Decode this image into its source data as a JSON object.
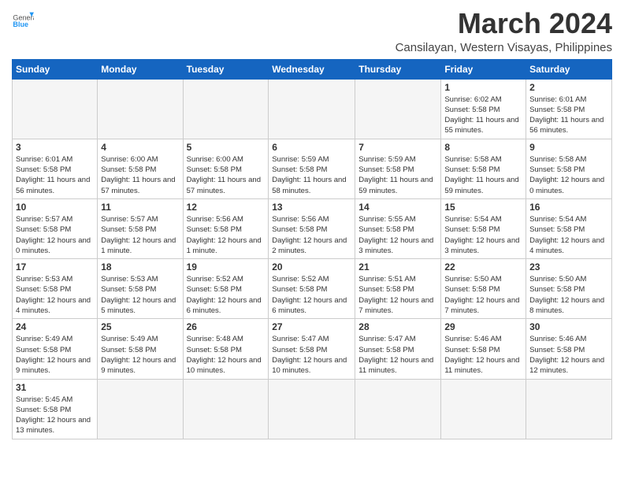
{
  "header": {
    "logo_general": "General",
    "logo_blue": "Blue",
    "month_title": "March 2024",
    "subtitle": "Cansilayan, Western Visayas, Philippines"
  },
  "days_of_week": [
    "Sunday",
    "Monday",
    "Tuesday",
    "Wednesday",
    "Thursday",
    "Friday",
    "Saturday"
  ],
  "weeks": [
    [
      {
        "day": "",
        "info": ""
      },
      {
        "day": "",
        "info": ""
      },
      {
        "day": "",
        "info": ""
      },
      {
        "day": "",
        "info": ""
      },
      {
        "day": "",
        "info": ""
      },
      {
        "day": "1",
        "info": "Sunrise: 6:02 AM\nSunset: 5:58 PM\nDaylight: 11 hours\nand 55 minutes."
      },
      {
        "day": "2",
        "info": "Sunrise: 6:01 AM\nSunset: 5:58 PM\nDaylight: 11 hours\nand 56 minutes."
      }
    ],
    [
      {
        "day": "3",
        "info": "Sunrise: 6:01 AM\nSunset: 5:58 PM\nDaylight: 11 hours\nand 56 minutes."
      },
      {
        "day": "4",
        "info": "Sunrise: 6:00 AM\nSunset: 5:58 PM\nDaylight: 11 hours\nand 57 minutes."
      },
      {
        "day": "5",
        "info": "Sunrise: 6:00 AM\nSunset: 5:58 PM\nDaylight: 11 hours\nand 57 minutes."
      },
      {
        "day": "6",
        "info": "Sunrise: 5:59 AM\nSunset: 5:58 PM\nDaylight: 11 hours\nand 58 minutes."
      },
      {
        "day": "7",
        "info": "Sunrise: 5:59 AM\nSunset: 5:58 PM\nDaylight: 11 hours\nand 59 minutes."
      },
      {
        "day": "8",
        "info": "Sunrise: 5:58 AM\nSunset: 5:58 PM\nDaylight: 11 hours\nand 59 minutes."
      },
      {
        "day": "9",
        "info": "Sunrise: 5:58 AM\nSunset: 5:58 PM\nDaylight: 12 hours\nand 0 minutes."
      }
    ],
    [
      {
        "day": "10",
        "info": "Sunrise: 5:57 AM\nSunset: 5:58 PM\nDaylight: 12 hours\nand 0 minutes."
      },
      {
        "day": "11",
        "info": "Sunrise: 5:57 AM\nSunset: 5:58 PM\nDaylight: 12 hours\nand 1 minute."
      },
      {
        "day": "12",
        "info": "Sunrise: 5:56 AM\nSunset: 5:58 PM\nDaylight: 12 hours\nand 1 minute."
      },
      {
        "day": "13",
        "info": "Sunrise: 5:56 AM\nSunset: 5:58 PM\nDaylight: 12 hours\nand 2 minutes."
      },
      {
        "day": "14",
        "info": "Sunrise: 5:55 AM\nSunset: 5:58 PM\nDaylight: 12 hours\nand 3 minutes."
      },
      {
        "day": "15",
        "info": "Sunrise: 5:54 AM\nSunset: 5:58 PM\nDaylight: 12 hours\nand 3 minutes."
      },
      {
        "day": "16",
        "info": "Sunrise: 5:54 AM\nSunset: 5:58 PM\nDaylight: 12 hours\nand 4 minutes."
      }
    ],
    [
      {
        "day": "17",
        "info": "Sunrise: 5:53 AM\nSunset: 5:58 PM\nDaylight: 12 hours\nand 4 minutes."
      },
      {
        "day": "18",
        "info": "Sunrise: 5:53 AM\nSunset: 5:58 PM\nDaylight: 12 hours\nand 5 minutes."
      },
      {
        "day": "19",
        "info": "Sunrise: 5:52 AM\nSunset: 5:58 PM\nDaylight: 12 hours\nand 6 minutes."
      },
      {
        "day": "20",
        "info": "Sunrise: 5:52 AM\nSunset: 5:58 PM\nDaylight: 12 hours\nand 6 minutes."
      },
      {
        "day": "21",
        "info": "Sunrise: 5:51 AM\nSunset: 5:58 PM\nDaylight: 12 hours\nand 7 minutes."
      },
      {
        "day": "22",
        "info": "Sunrise: 5:50 AM\nSunset: 5:58 PM\nDaylight: 12 hours\nand 7 minutes."
      },
      {
        "day": "23",
        "info": "Sunrise: 5:50 AM\nSunset: 5:58 PM\nDaylight: 12 hours\nand 8 minutes."
      }
    ],
    [
      {
        "day": "24",
        "info": "Sunrise: 5:49 AM\nSunset: 5:58 PM\nDaylight: 12 hours\nand 9 minutes."
      },
      {
        "day": "25",
        "info": "Sunrise: 5:49 AM\nSunset: 5:58 PM\nDaylight: 12 hours\nand 9 minutes."
      },
      {
        "day": "26",
        "info": "Sunrise: 5:48 AM\nSunset: 5:58 PM\nDaylight: 12 hours\nand 10 minutes."
      },
      {
        "day": "27",
        "info": "Sunrise: 5:47 AM\nSunset: 5:58 PM\nDaylight: 12 hours\nand 10 minutes."
      },
      {
        "day": "28",
        "info": "Sunrise: 5:47 AM\nSunset: 5:58 PM\nDaylight: 12 hours\nand 11 minutes."
      },
      {
        "day": "29",
        "info": "Sunrise: 5:46 AM\nSunset: 5:58 PM\nDaylight: 12 hours\nand 11 minutes."
      },
      {
        "day": "30",
        "info": "Sunrise: 5:46 AM\nSunset: 5:58 PM\nDaylight: 12 hours\nand 12 minutes."
      }
    ],
    [
      {
        "day": "31",
        "info": "Sunrise: 5:45 AM\nSunset: 5:58 PM\nDaylight: 12 hours\nand 13 minutes."
      },
      {
        "day": "",
        "info": ""
      },
      {
        "day": "",
        "info": ""
      },
      {
        "day": "",
        "info": ""
      },
      {
        "day": "",
        "info": ""
      },
      {
        "day": "",
        "info": ""
      },
      {
        "day": "",
        "info": ""
      }
    ]
  ]
}
